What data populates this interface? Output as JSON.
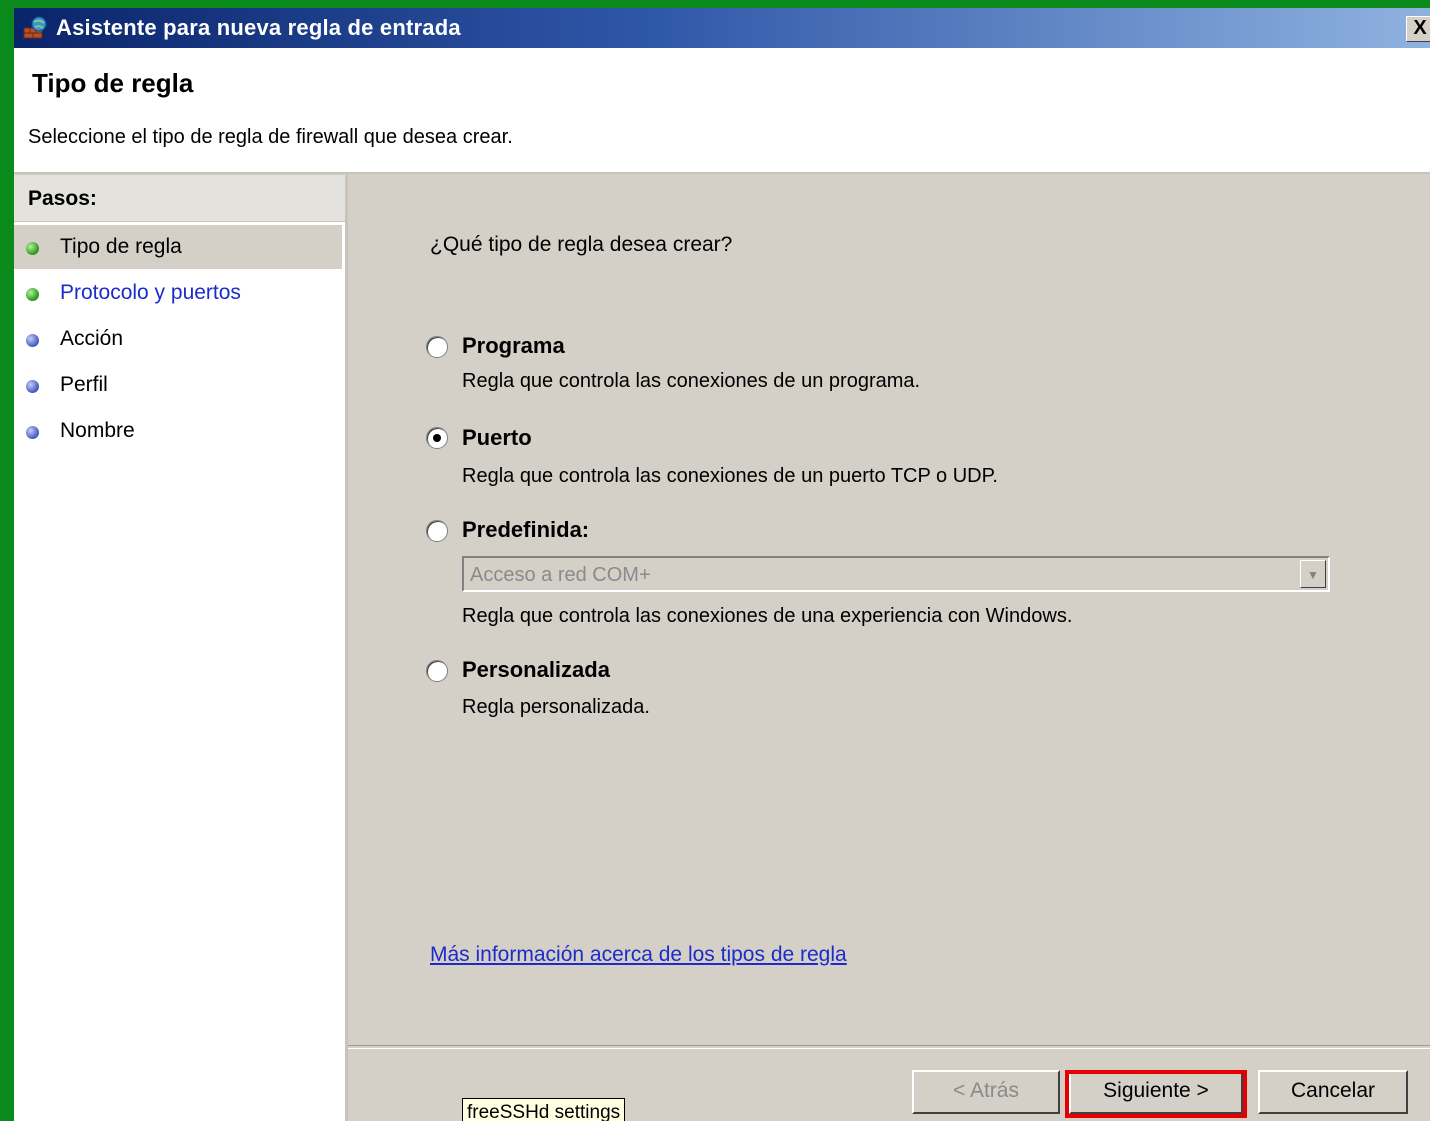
{
  "window": {
    "title": "Asistente para nueva regla de entrada",
    "close_label": "X"
  },
  "header": {
    "title": "Tipo de regla",
    "description": "Seleccione el tipo de regla de firewall que desea crear."
  },
  "steps": {
    "title": "Pasos:",
    "items": [
      {
        "label": "Tipo de regla",
        "dot": "green",
        "active": true
      },
      {
        "label": "Protocolo y puertos",
        "dot": "green",
        "link": true
      },
      {
        "label": "Acción",
        "dot": "blue"
      },
      {
        "label": "Perfil",
        "dot": "blue"
      },
      {
        "label": "Nombre",
        "dot": "blue"
      }
    ]
  },
  "content": {
    "question": "¿Qué tipo de regla desea crear?",
    "options": [
      {
        "label": "Programa",
        "description": "Regla que controla las conexiones de un programa.",
        "selected": false
      },
      {
        "label": "Puerto",
        "description": "Regla que controla las conexiones de un puerto TCP o UDP.",
        "selected": true
      },
      {
        "label": "Predefinida:",
        "description": "Regla que controla las conexiones de una experiencia con Windows.",
        "selected": false
      },
      {
        "label": "Personalizada",
        "description": "Regla personalizada.",
        "selected": false
      }
    ],
    "predefined_select": {
      "value": "Acceso a red COM+",
      "disabled": true
    },
    "more_info_link": "Más información acerca de los tipos de regla"
  },
  "buttons": {
    "back": "< Atrás",
    "next": "Siguiente >",
    "cancel": "Cancelar"
  },
  "tooltip": "freeSSHd settings",
  "colors": {
    "desktop": "#0a8a1a",
    "link": "#1c2cc8",
    "highlight": "#e60000"
  }
}
